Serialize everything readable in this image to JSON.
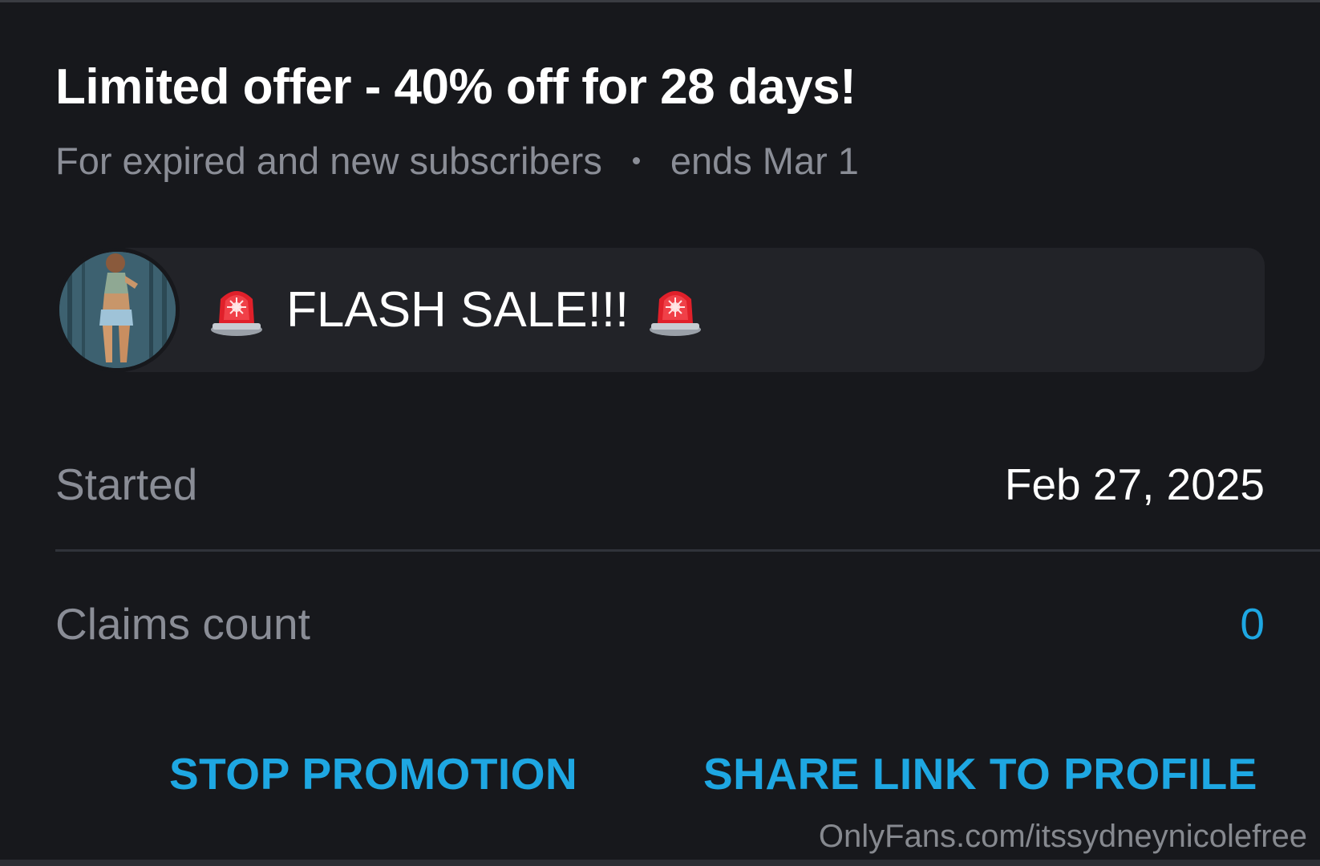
{
  "offer": {
    "title": "Limited offer - 40% off for 28 days!",
    "audience": "For expired and new subscribers",
    "ends": "ends Mar 1"
  },
  "message": {
    "text": "FLASH SALE!!!",
    "leading_icon": "police-siren-emoji",
    "trailing_icon": "police-siren-emoji"
  },
  "stats": {
    "started_label": "Started",
    "started_value": "Feb 27, 2025",
    "claims_label": "Claims count",
    "claims_value": "0"
  },
  "actions": {
    "stop_label": "STOP PROMOTION",
    "share_label": "SHARE LINK TO PROFILE"
  },
  "watermark": "OnlyFans.com/itssydneynicolefree",
  "colors": {
    "background": "#17181c",
    "bubble": "#222328",
    "accent": "#1ea7e2",
    "muted_text": "#8a8d96"
  }
}
